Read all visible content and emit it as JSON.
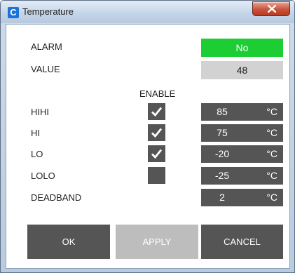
{
  "window": {
    "title": "Temperature",
    "app_icon_letter": "C"
  },
  "alarm": {
    "label": "ALARM",
    "value": "No",
    "color": "#1ccd34"
  },
  "value": {
    "label": "VALUE",
    "value": "48"
  },
  "enable_header": "ENABLE",
  "rows": [
    {
      "label": "HIHI",
      "enabled": true,
      "value": "85",
      "unit": "°C"
    },
    {
      "label": "HI",
      "enabled": true,
      "value": "75",
      "unit": "°C"
    },
    {
      "label": "LO",
      "enabled": true,
      "value": "-20",
      "unit": "°C"
    },
    {
      "label": "LOLO",
      "enabled": false,
      "value": "-25",
      "unit": "°C"
    }
  ],
  "deadband": {
    "label": "DEADBAND",
    "value": "2",
    "unit": "°C"
  },
  "buttons": {
    "ok": "OK",
    "apply": "APPLY",
    "cancel": "CANCEL"
  }
}
